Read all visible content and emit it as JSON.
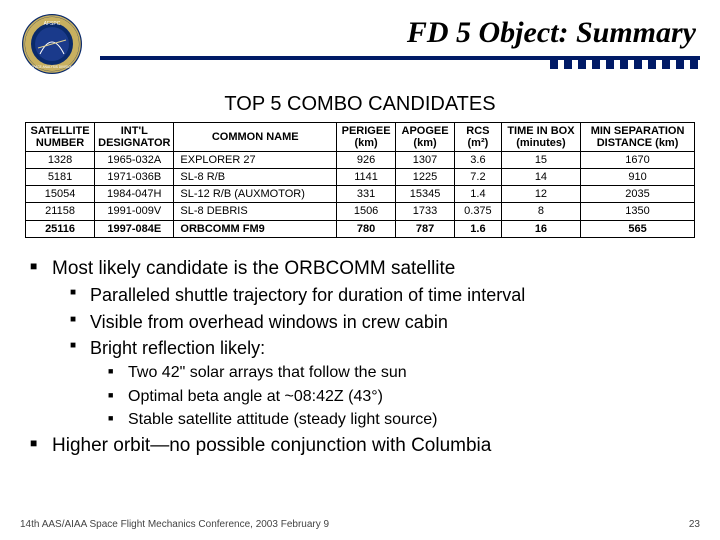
{
  "header": {
    "title": "FD 5 Object: Summary",
    "logo_top": "AFSPC",
    "logo_bottom": "SPACE ANALYSIS DIVISION"
  },
  "subheader": "TOP 5 COMBO CANDIDATES",
  "table": {
    "headers": [
      "SATELLITE NUMBER",
      "INT'L DESIGNATOR",
      "COMMON NAME",
      "PERIGEE (km)",
      "APOGEE (km)",
      "RCS (m²)",
      "TIME IN BOX (minutes)",
      "MIN SEPARATION DISTANCE (km)"
    ],
    "rows": [
      {
        "cells": [
          "1328",
          "1965-032A",
          "EXPLORER 27",
          "926",
          "1307",
          "3.6",
          "15",
          "1670"
        ],
        "bold": false
      },
      {
        "cells": [
          "5181",
          "1971-036B",
          "SL-8 R/B",
          "1141",
          "1225",
          "7.2",
          "14",
          "910"
        ],
        "bold": false
      },
      {
        "cells": [
          "15054",
          "1984-047H",
          "SL-12 R/B (AUXMOTOR)",
          "331",
          "15345",
          "1.4",
          "12",
          "2035"
        ],
        "bold": false
      },
      {
        "cells": [
          "21158",
          "1991-009V",
          "SL-8 DEBRIS",
          "1506",
          "1733",
          "0.375",
          "8",
          "1350"
        ],
        "bold": false
      },
      {
        "cells": [
          "25116",
          "1997-084E",
          "ORBCOMM FM9",
          "780",
          "787",
          "1.6",
          "16",
          "565"
        ],
        "bold": true
      }
    ]
  },
  "bullets": {
    "b1": "Most likely candidate is the ORBCOMM satellite",
    "b1a": "Paralleled shuttle trajectory for duration of time interval",
    "b1b": "Visible from overhead windows in crew cabin",
    "b1c": "Bright reflection likely:",
    "b1c1": "Two 42\" solar arrays that follow the sun",
    "b1c2": "Optimal beta angle at ~08:42Z (43°)",
    "b1c3": "Stable satellite attitude (steady light source)",
    "b2": "Higher orbit—no possible conjunction with Columbia"
  },
  "footer": {
    "left": "14th AAS/AIAA Space Flight Mechanics Conference, 2003 February 9",
    "right": "23"
  }
}
